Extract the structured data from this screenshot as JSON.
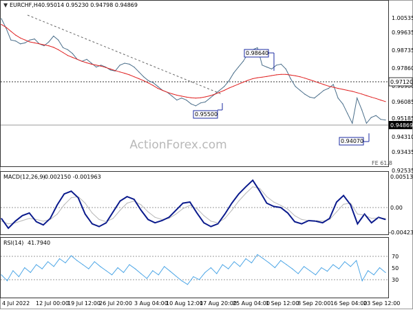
{
  "header": {
    "symbol": "EURCHF,H4",
    "ohlc": "0.95014 0.95230 0.94798 0.94869"
  },
  "watermark": "ActionForex.com",
  "colors": {
    "price": "#4a6e8a",
    "ma": "#e02020",
    "macd": "#0a1a8c",
    "signal": "#b8b8b8",
    "rsi": "#4da6e6",
    "label_border": "#1a2aa0",
    "current_tag": "#000000"
  },
  "chart_data": [
    {
      "type": "line",
      "pane": "price",
      "ylim": [
        0.9255,
        1.0085
      ],
      "x_categories": [
        "4 Jul 2022",
        "12 Jul 00:00",
        "19 Jul 12:00",
        "26 Jul 20:00",
        "3 Aug 04:00",
        "10 Aug 12:00",
        "17 Aug 20:00",
        "25 Aug 04:00",
        "1 Sep 12:00",
        "8 Sep 20:00",
        "16 Sep 04:00",
        "23 Sep 12:00"
      ],
      "y_ticks": [
        "1.00535",
        "0.99635",
        "0.98735",
        "0.97860",
        "0.96980",
        "0.96085",
        "0.95185",
        "0.94310",
        "0.93435",
        "0.92535"
      ],
      "annotations": {
        "high": "0.98640",
        "low1": "0.95500",
        "low2": "0.94070",
        "level": "0.97120",
        "current": "0.94869",
        "fe": "FE 61.8"
      },
      "series": [
        {
          "values": [
            1.001,
            0.996,
            0.99,
            0.9895,
            0.988,
            0.9885,
            0.99,
            0.9905,
            0.988,
            0.987,
            0.989,
            0.992,
            0.99,
            0.986,
            0.985,
            0.983,
            0.98,
            0.979,
            0.98,
            0.978,
            0.976,
            0.977,
            0.976,
            0.9745,
            0.974,
            0.977,
            0.978,
            0.9775,
            0.976,
            0.9735,
            0.971,
            0.969,
            0.968,
            0.966,
            0.964,
            0.963,
            0.961,
            0.959,
            0.96,
            0.959,
            0.957,
            0.956,
            0.9575,
            0.958,
            0.96,
            0.962,
            0.964,
            0.966,
            0.969,
            0.973,
            0.976,
            0.979,
            0.983,
            0.985,
            0.986,
            0.977,
            0.976,
            0.975,
            0.977,
            0.9775,
            0.975,
            0.97,
            0.966,
            0.964,
            0.962,
            0.9605,
            0.96,
            0.962,
            0.964,
            0.965,
            0.967,
            0.96,
            0.957,
            0.952,
            0.947,
            0.96,
            0.954,
            0.947,
            0.95,
            0.951,
            0.949,
            0.9487
          ]
        },
        {
          "values": [
            0.998,
            0.9965,
            0.9945,
            0.9925,
            0.991,
            0.99,
            0.989,
            0.9885,
            0.988,
            0.9875,
            0.987,
            0.9862,
            0.985,
            0.9835,
            0.982,
            0.981,
            0.98,
            0.979,
            0.9782,
            0.9775,
            0.977,
            0.9765,
            0.9758,
            0.975,
            0.9742,
            0.9735,
            0.9728,
            0.972,
            0.971,
            0.97,
            0.969,
            0.9678,
            0.9665,
            0.965,
            0.964,
            0.963,
            0.9622,
            0.9615,
            0.961,
            0.9605,
            0.9602,
            0.96,
            0.9602,
            0.9606,
            0.9612,
            0.962,
            0.963,
            0.964,
            0.9652,
            0.9662,
            0.9672,
            0.9682,
            0.9692,
            0.97,
            0.9705,
            0.9708,
            0.9712,
            0.9716,
            0.972,
            0.9722,
            0.9722,
            0.9719,
            0.9715,
            0.971,
            0.9703,
            0.9695,
            0.9687,
            0.9678,
            0.967,
            0.9662,
            0.9656,
            0.965,
            0.9645,
            0.964,
            0.9635,
            0.9628,
            0.9621,
            0.9613,
            0.9605,
            0.9598,
            0.959,
            0.9582
          ]
        }
      ]
    },
    {
      "type": "line",
      "pane": "macd",
      "title": "MACD(12,26,9)",
      "values_text": "-0.002150 -0.001963",
      "ylim": [
        -0.0048,
        0.0058
      ],
      "y_ticks": [
        "0.005137",
        "0.00",
        "-0.004239"
      ],
      "series": [
        {
          "values": [
            -0.002,
            -0.0038,
            -0.0025,
            -0.0015,
            -0.001,
            -0.0026,
            -0.0032,
            -0.002,
            0.0005,
            0.0025,
            0.003,
            0.0018,
            -0.0012,
            -0.003,
            -0.0035,
            -0.0028,
            -0.0008,
            0.0012,
            0.002,
            0.0015,
            -0.0005,
            -0.0022,
            -0.0028,
            -0.0024,
            -0.0018,
            -0.0005,
            0.0008,
            0.001,
            -0.001,
            -0.0028,
            -0.0035,
            -0.003,
            -0.0012,
            0.0008,
            0.0025,
            0.0038,
            0.005,
            0.003,
            0.0008,
            0.0002,
            0.0,
            -0.001,
            -0.0026,
            -0.003,
            -0.0024,
            -0.0025,
            -0.0028,
            -0.002,
            0.001,
            0.0022,
            0.0005,
            -0.003,
            -0.0012,
            -0.0028,
            -0.0018,
            -0.0022
          ]
        },
        {
          "values": [
            -0.0025,
            -0.003,
            -0.0028,
            -0.0024,
            -0.002,
            -0.0022,
            -0.0025,
            -0.0022,
            -0.0012,
            0.0005,
            0.0018,
            0.002,
            0.0008,
            -0.001,
            -0.0022,
            -0.0026,
            -0.002,
            -0.0005,
            0.0008,
            0.0012,
            0.0005,
            -0.0008,
            -0.0018,
            -0.0022,
            -0.002,
            -0.0012,
            -0.0002,
            0.0004,
            -0.0002,
            -0.0015,
            -0.0025,
            -0.0028,
            -0.002,
            -0.0005,
            0.0012,
            0.0026,
            0.0038,
            0.0035,
            0.002,
            0.001,
            0.0004,
            -0.0003,
            -0.0015,
            -0.0022,
            -0.0024,
            -0.0024,
            -0.0025,
            -0.0022,
            -0.0008,
            0.0006,
            0.0008,
            -0.0012,
            -0.0014,
            -0.002,
            -0.0019,
            -0.002
          ]
        }
      ]
    },
    {
      "type": "line",
      "pane": "rsi",
      "title": "RSI(14)",
      "values_text": "41.7940",
      "ylim": [
        0,
        100
      ],
      "y_ticks": [
        "70",
        "50",
        "30"
      ],
      "series": [
        {
          "values": [
            38,
            28,
            45,
            35,
            50,
            42,
            55,
            48,
            60,
            52,
            65,
            58,
            70,
            62,
            55,
            48,
            60,
            52,
            45,
            38,
            50,
            42,
            55,
            48,
            40,
            32,
            45,
            38,
            52,
            44,
            36,
            28,
            22,
            35,
            30,
            42,
            50,
            40,
            55,
            48,
            60,
            52,
            65,
            58,
            72,
            65,
            58,
            50,
            62,
            55,
            48,
            40,
            52,
            45,
            38,
            50,
            44,
            55,
            48,
            60,
            52,
            62,
            28,
            45,
            38,
            50,
            42
          ]
        }
      ]
    }
  ]
}
